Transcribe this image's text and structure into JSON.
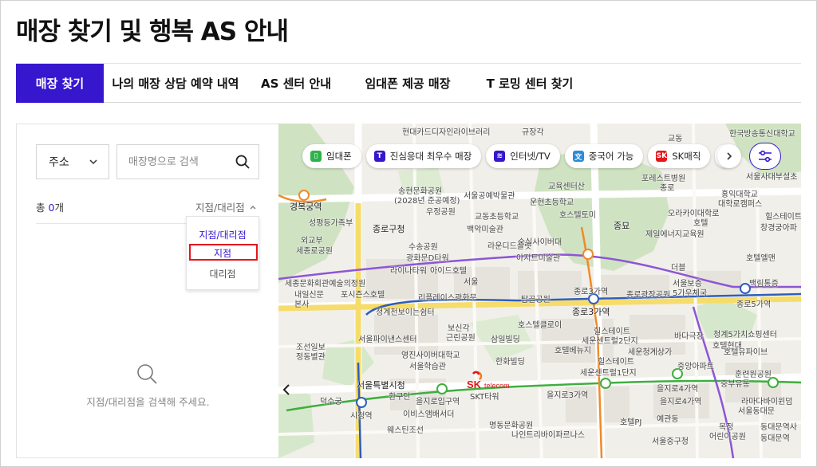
{
  "page": {
    "title": "매장 찾기 및 행복 AS 안내"
  },
  "tabs": [
    {
      "label": "매장 찾기",
      "active": true
    },
    {
      "label": "나의 매장 상담 예약 내역",
      "active": false
    },
    {
      "label": "AS 센터 안내",
      "active": false
    },
    {
      "label": "임대폰 제공 매장",
      "active": false
    },
    {
      "label": "T 로밍 센터 찾기",
      "active": false
    }
  ],
  "filter": {
    "select_value": "주소",
    "search_placeholder": "매장명으로 검색",
    "count_prefix": "총 ",
    "count_value": "0",
    "count_suffix": "개",
    "type_selected": "지점/대리점",
    "dropdown_options": [
      "지점/대리점",
      "지점",
      "대리점"
    ]
  },
  "empty_state": {
    "message": "지점/대리점을 검색해 주세요."
  },
  "map": {
    "chips": [
      {
        "label": "임대폰",
        "icon": "phone-icon",
        "color": "#2eb24a"
      },
      {
        "label": "진심응대 최우수 매장",
        "icon": "t-logo-icon",
        "color": "#3617ce"
      },
      {
        "label": "인터넷/TV",
        "icon": "router-icon",
        "color": "#3617ce"
      },
      {
        "label": "중국어 가능",
        "icon": "language-icon",
        "color": "#2a8bd8"
      },
      {
        "label": "SK매직",
        "icon": "sk-logo-icon",
        "color": "#e3161b"
      }
    ],
    "logo": {
      "brand": "SK",
      "sub": "telecom"
    },
    "labels": [
      "현대카드디자인라이브러리",
      "규장각",
      "교동",
      "한국방송통신대",
      "한국방송통신대학교",
      "송현문화공원",
      "(2028년 준공예정)",
      "서울공예박물관",
      "교육센터산",
      "포레스트병원",
      "종로",
      "서울사대부설초",
      "홍익대학교",
      "대학로캠퍼스",
      "경복궁역",
      "성평등가족부",
      "우정공원",
      "교동초등학교",
      "운현초등학교",
      "호스텔토미",
      "오라카이대학로",
      "호텔",
      "힐스테이트",
      "창경궁아파",
      "종로구청",
      "백악미술관",
      "수송공원",
      "종묘",
      "제일에너지교육원",
      "외교부",
      "라운디드플랫",
      "광화문D타워",
      "숭실사이버대",
      "세종로공원",
      "아지트미술관",
      "라이나타워",
      "아이드호텔",
      "서울",
      "호텔엘맨",
      "더블",
      "세종문화회관예술의정원",
      "포시즌스호텔",
      "종로3가역",
      "서울보증",
      "5가우체국",
      "백림통증",
      "내일신문",
      "리플레이스광화문",
      "종로광장공원",
      "종로5가역",
      "본사",
      "탑골공원",
      "청계천보이는쉼터",
      "보신각",
      "종로3가역",
      "호스텔클로이",
      "근린공원",
      "힐스테이트",
      "세운센트럴2단지",
      "바다극장",
      "청계5가치쇼핑센터",
      "호텔현대",
      "서울파이낸스센터",
      "영진사이버대학교",
      "서울학습관",
      "삼일빌딩",
      "호텔베뉴지",
      "세운청계상가",
      "호텔유파이브",
      "중앙아파트",
      "조선일보",
      "정동별관",
      "한화빌딩",
      "힐스테이트",
      "세운센트럴1단지",
      "훈련원공원",
      "중부유통",
      "서울특별시청",
      "을지로입구역",
      "을지로3가역",
      "을지로4가역",
      "덕수궁",
      "환구단",
      "SKT타워",
      "을지로4가역",
      "라마다바이윈덤",
      "서울동대문",
      "시청역",
      "이비스앰배서더",
      "명동문화공원",
      "호텔PJ",
      "목정",
      "어린이공원",
      "동대문역사",
      "웨스틴조선",
      "나인트리바이파르나스",
      "예관동",
      "서울중구청",
      "동대문역"
    ]
  }
}
